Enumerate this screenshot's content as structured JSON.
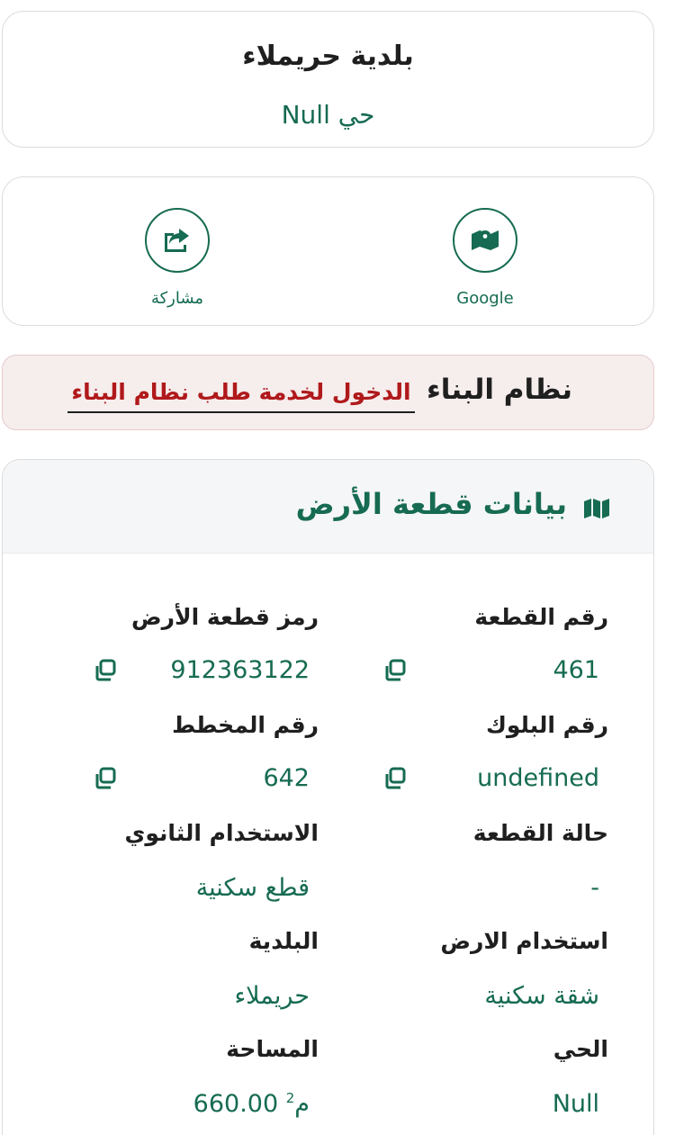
{
  "municipality": {
    "title": "بلدية حريملاء",
    "district": "حي Null"
  },
  "actions": {
    "share_label": "مشاركة",
    "google_label": "Google"
  },
  "building_system": {
    "title": "نظام البناء",
    "link": "الدخول لخدمة طلب نظام البناء"
  },
  "land": {
    "title": "بيانات قطعة الأرض",
    "fields": {
      "plot_number": {
        "label": "رقم القطعة",
        "value": "461"
      },
      "plot_code": {
        "label": "رمز قطعة الأرض",
        "value": "912363122"
      },
      "block_number": {
        "label": "رقم البلوك",
        "value": "undefined"
      },
      "plan_number": {
        "label": "رقم المخطط",
        "value": "642"
      },
      "plot_status": {
        "label": "حالة القطعة",
        "value": "-"
      },
      "secondary_use": {
        "label": "الاستخدام الثانوي",
        "value": "قطع سكنية"
      },
      "land_use": {
        "label": "استخدام الارض",
        "value": "شقة سكنية"
      },
      "municipality": {
        "label": "البلدية",
        "value": "حريملاء"
      },
      "district": {
        "label": "الحي",
        "value": "Null"
      },
      "area": {
        "label": "المساحة",
        "value": "660.00 م",
        "unit_sup": "2"
      }
    }
  },
  "colors": {
    "accent_green": "#166b52",
    "link_red": "#b0191b",
    "alert_bg": "#f6eded"
  }
}
